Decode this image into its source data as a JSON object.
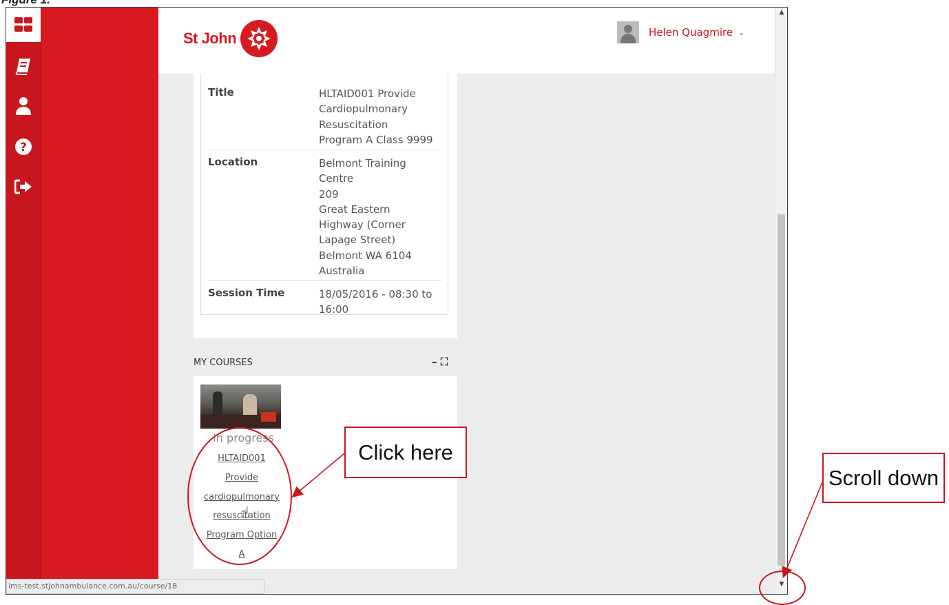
{
  "figure_label": "Figure 1.",
  "sidebar": {
    "icons": [
      "dashboard-icon",
      "book-icon",
      "user-icon",
      "help-icon",
      "logout-icon"
    ]
  },
  "header": {
    "logo_text": "St John",
    "user_name": "Helen Quagmire"
  },
  "session_details": {
    "rows": [
      {
        "label": "Title",
        "value": "HLTAID001 Provide\nCardiopulmonary\nResuscitation\nProgram A Class 9999"
      },
      {
        "label": "Location",
        "value": "Belmont Training\nCentre\n209\nGreat Eastern\nHighway (Corner\nLapage Street)\nBelmont  WA  6104\nAustralia"
      },
      {
        "label": "Session Time",
        "value": "18/05/2016 - 08:30 to\n16:00"
      }
    ]
  },
  "my_courses": {
    "title": "MY COURSES",
    "controls": "– ⛶",
    "course": {
      "status": "In progress",
      "link_text": "HLTAID001\nProvide\ncardiopulmonary\nresuscitation\nProgram Option\nA"
    }
  },
  "status_bar": {
    "url": "lms-test.stjohnambulance.com.au/course/18"
  },
  "annotations": {
    "click_here": "Click here",
    "scroll_down": "Scroll down",
    "color": "#c8161f"
  },
  "colors": {
    "brand_red": "#d71920",
    "sidebar_red": "#c8161f",
    "content_bg": "#ececec"
  }
}
